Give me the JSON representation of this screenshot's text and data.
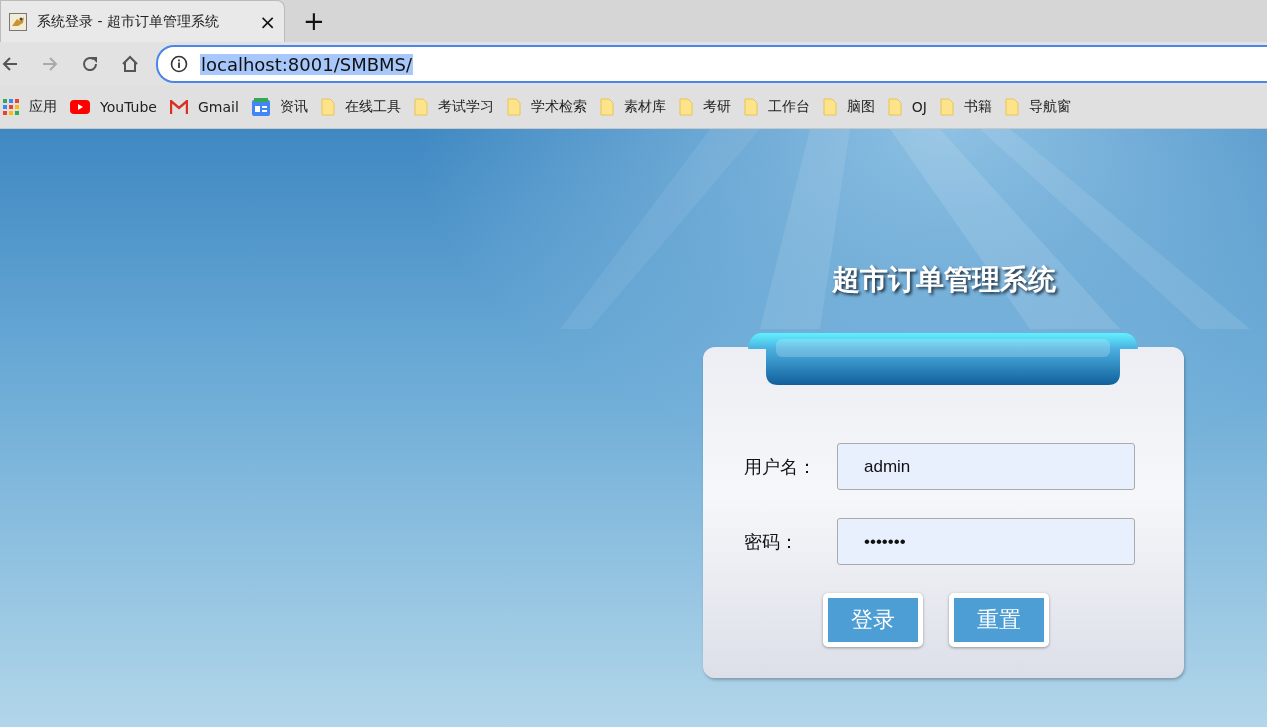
{
  "tab": {
    "title": "系统登录 - 超市订单管理系统",
    "close": "×",
    "new_tab": "+"
  },
  "address_bar": {
    "url": "localhost:8001/SMBMS/",
    "selected": true
  },
  "bookmarks": [
    {
      "kind": "apps",
      "label": "应用"
    },
    {
      "kind": "youtube",
      "label": "YouTube"
    },
    {
      "kind": "gmail",
      "label": "Gmail"
    },
    {
      "kind": "news",
      "label": "资讯"
    },
    {
      "kind": "folder",
      "label": "在线工具"
    },
    {
      "kind": "folder",
      "label": "考试学习"
    },
    {
      "kind": "folder",
      "label": "学术检索"
    },
    {
      "kind": "folder",
      "label": "素材库"
    },
    {
      "kind": "folder",
      "label": "考研"
    },
    {
      "kind": "folder",
      "label": "工作台"
    },
    {
      "kind": "folder",
      "label": "脑图"
    },
    {
      "kind": "folder",
      "label": "OJ"
    },
    {
      "kind": "folder",
      "label": "书籍"
    },
    {
      "kind": "folder",
      "label": "导航窗"
    }
  ],
  "login": {
    "title": "超市订单管理系统",
    "fields": [
      {
        "label": "用户名：",
        "value": "admin"
      },
      {
        "label": "密码：",
        "value": "•••••••"
      }
    ],
    "buttons": [
      "登录",
      "重置"
    ]
  }
}
